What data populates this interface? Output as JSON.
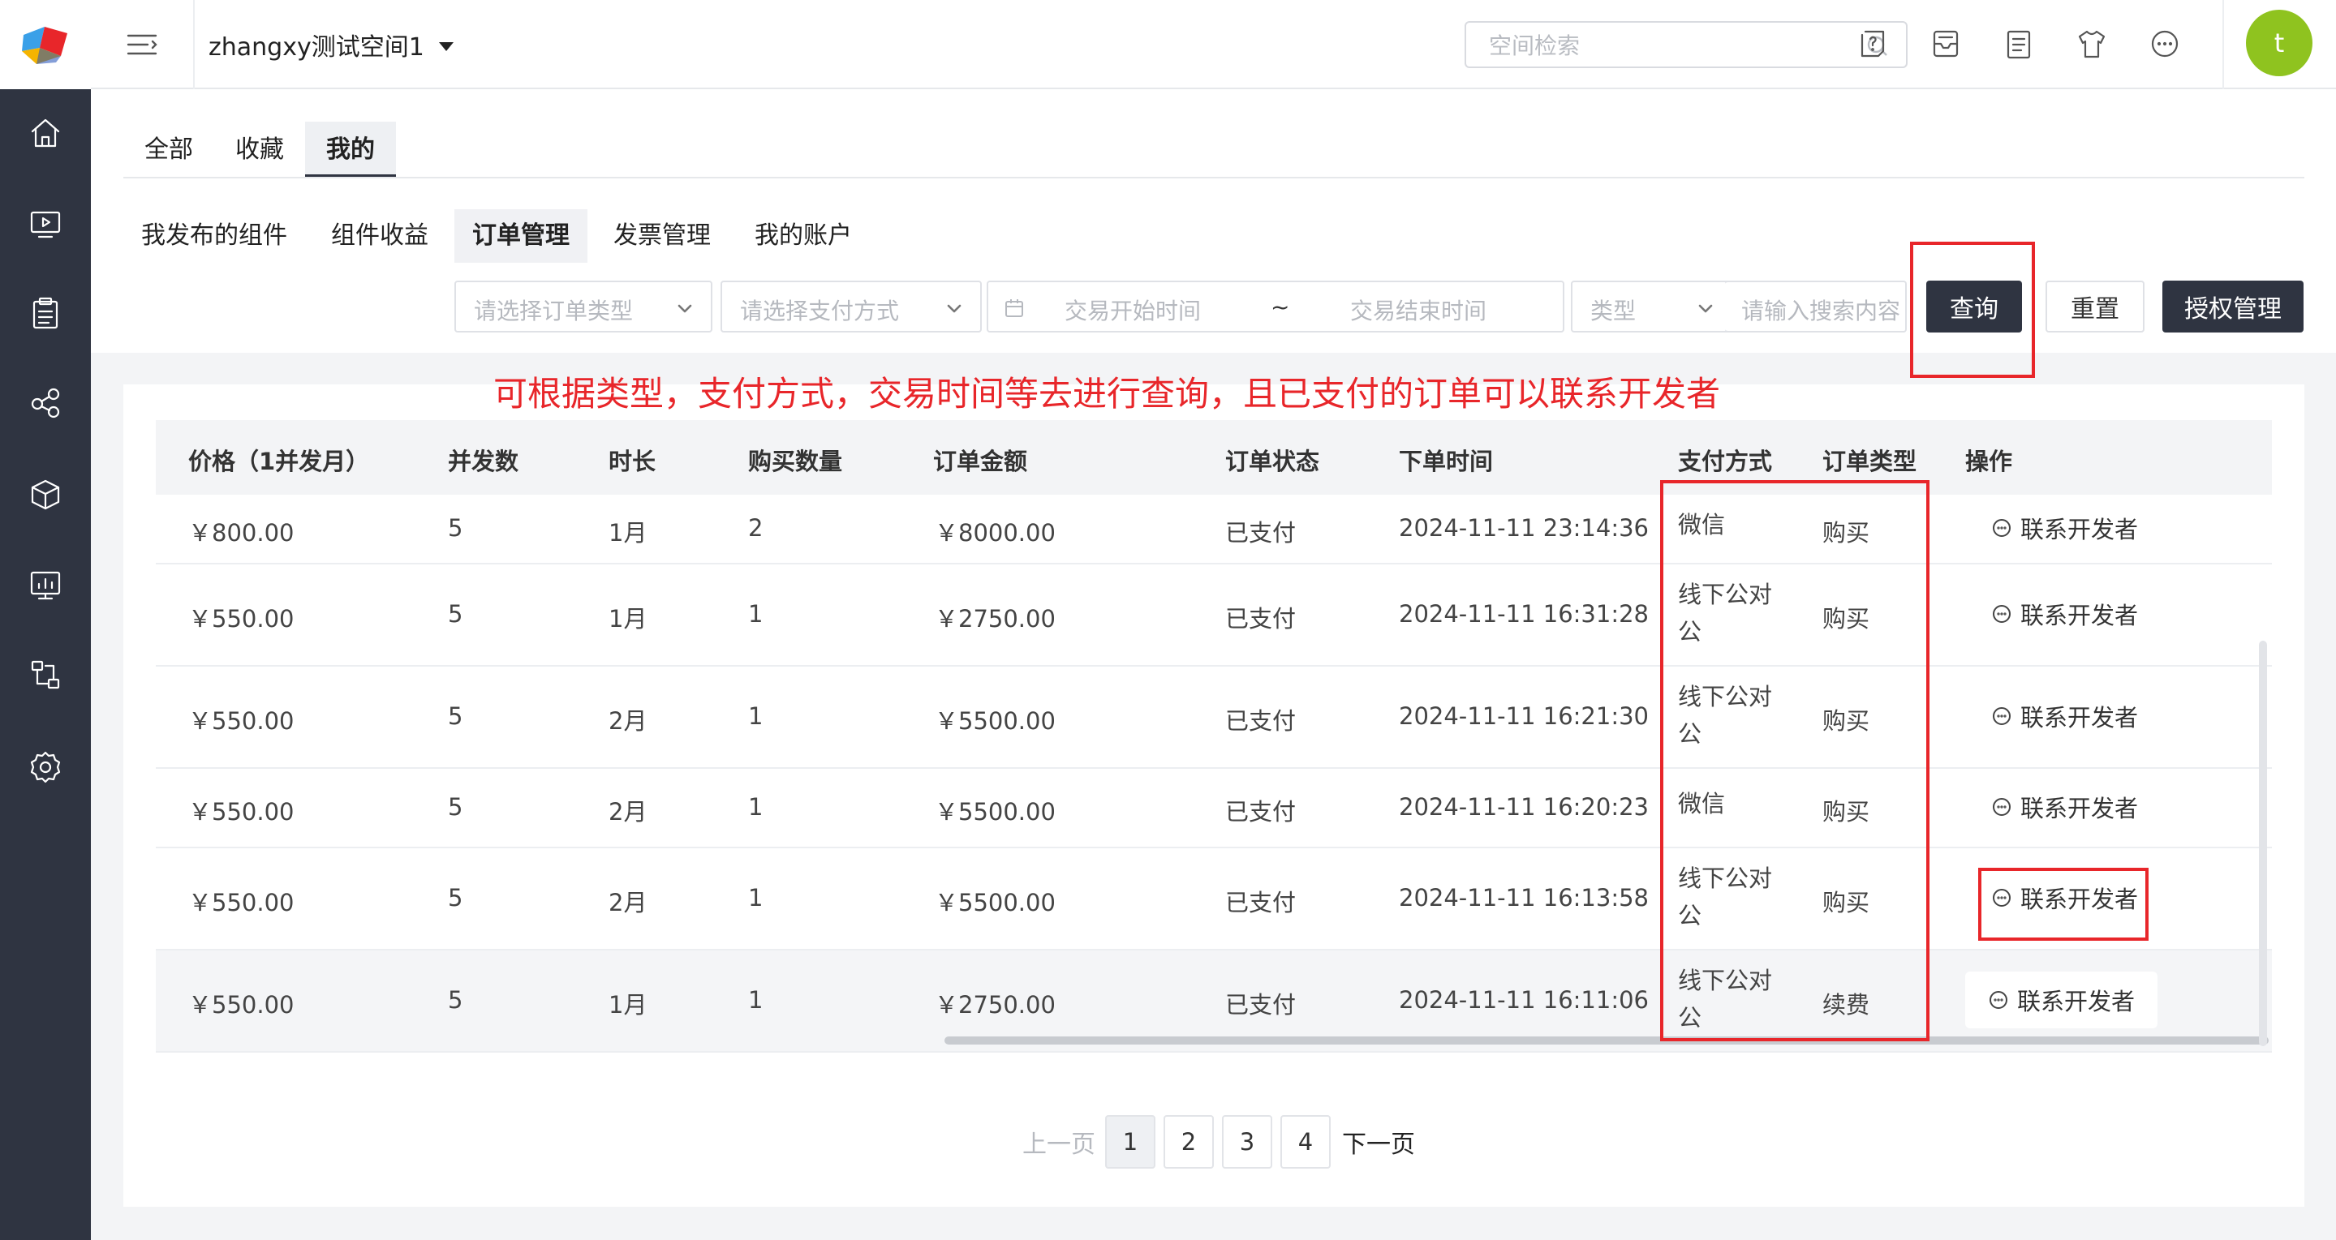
{
  "header": {
    "workspace_name": "zhangxy测试空间1",
    "search_placeholder": "空间检索",
    "avatar_letter": "t"
  },
  "tabs_primary": [
    {
      "label": "全部",
      "active": false
    },
    {
      "label": "收藏",
      "active": false
    },
    {
      "label": "我的",
      "active": true
    }
  ],
  "tabs_secondary": [
    {
      "label": "我发布的组件",
      "active": false
    },
    {
      "label": "组件收益",
      "active": false
    },
    {
      "label": "订单管理",
      "active": true
    },
    {
      "label": "发票管理",
      "active": false
    },
    {
      "label": "我的账户",
      "active": false
    }
  ],
  "filters": {
    "order_type_placeholder": "请选择订单类型",
    "pay_method_placeholder": "请选择支付方式",
    "start_time_placeholder": "交易开始时间",
    "range_separator": "~",
    "end_time_placeholder": "交易结束时间",
    "type_placeholder": "类型",
    "search_placeholder": "请输入搜索内容"
  },
  "buttons": {
    "query": "查询",
    "reset": "重置",
    "auth": "授权管理"
  },
  "annotation": "可根据类型，支付方式，交易时间等去进行查询，且已支付的订单可以联系开发者",
  "table": {
    "columns": [
      "价格（1并发月）",
      "并发数",
      "时长",
      "购买数量",
      "订单金额",
      "订单状态",
      "下单时间",
      "支付方式",
      "订单类型",
      "操作"
    ],
    "action_label": "联系开发者",
    "rows": [
      {
        "price": "￥800.00",
        "concurrency": "5",
        "duration": "1月",
        "quantity": "2",
        "amount": "￥8000.00",
        "status": "已支付",
        "time": "2024-11-11 23:14:36",
        "pay_method": "微信",
        "order_type": "购买"
      },
      {
        "price": "￥550.00",
        "concurrency": "5",
        "duration": "1月",
        "quantity": "1",
        "amount": "￥2750.00",
        "status": "已支付",
        "time": "2024-11-11 16:31:28",
        "pay_method": "线下公对公",
        "order_type": "购买"
      },
      {
        "price": "￥550.00",
        "concurrency": "5",
        "duration": "2月",
        "quantity": "1",
        "amount": "￥5500.00",
        "status": "已支付",
        "time": "2024-11-11 16:21:30",
        "pay_method": "线下公对公",
        "order_type": "购买"
      },
      {
        "price": "￥550.00",
        "concurrency": "5",
        "duration": "2月",
        "quantity": "1",
        "amount": "￥5500.00",
        "status": "已支付",
        "time": "2024-11-11 16:20:23",
        "pay_method": "微信",
        "order_type": "购买"
      },
      {
        "price": "￥550.00",
        "concurrency": "5",
        "duration": "2月",
        "quantity": "1",
        "amount": "￥5500.00",
        "status": "已支付",
        "time": "2024-11-11 16:13:58",
        "pay_method": "线下公对公",
        "order_type": "购买"
      },
      {
        "price": "￥550.00",
        "concurrency": "5",
        "duration": "1月",
        "quantity": "1",
        "amount": "￥2750.00",
        "status": "已支付",
        "time": "2024-11-11 16:11:06",
        "pay_method": "线下公对公",
        "order_type": "续费"
      }
    ]
  },
  "pagination": {
    "prev": "上一页",
    "next": "下一页",
    "pages": [
      "1",
      "2",
      "3",
      "4"
    ],
    "current": "1"
  },
  "colors": {
    "sidebar": "#2f3441",
    "primary_button": "#2f3441",
    "annotation_red": "#e8262a",
    "avatar_green": "#8fc31f"
  }
}
